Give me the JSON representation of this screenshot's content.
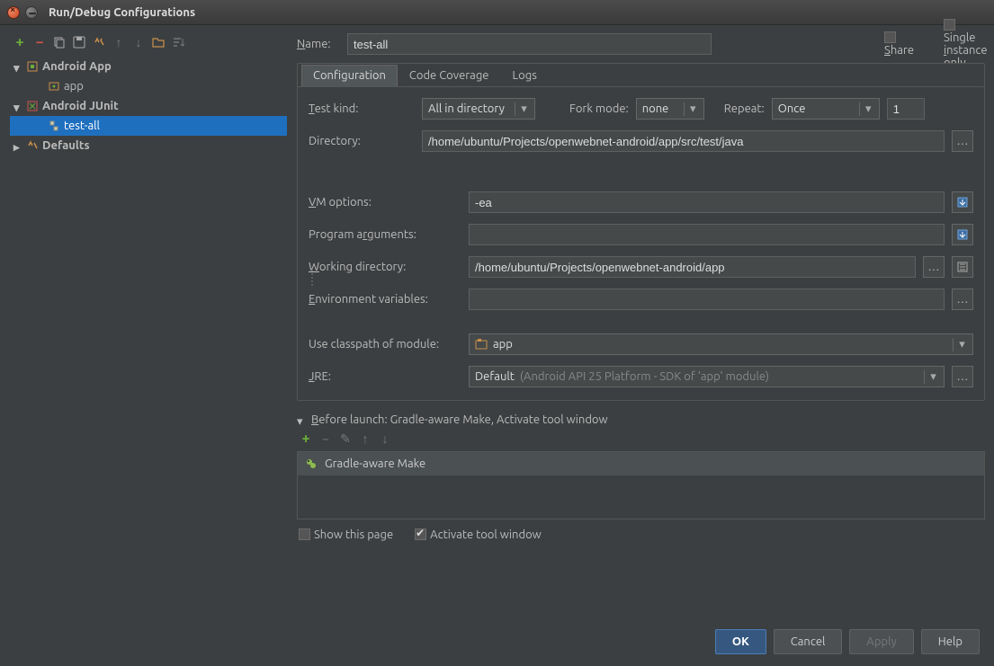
{
  "window": {
    "title": "Run/Debug Configurations"
  },
  "toolbar": {
    "addTip": "Add",
    "removeTip": "Remove",
    "copyTip": "Copy",
    "saveTip": "Save",
    "settingsTip": "Edit defaults",
    "upTip": "Move up",
    "downTip": "Move down",
    "folderTip": "Folder",
    "sortTip": "Sort"
  },
  "tree": {
    "androidApp": "Android App",
    "appItem": "app",
    "androidJUnit": "Android JUnit",
    "testAll": "test-all",
    "defaults": "Defaults"
  },
  "header": {
    "nameLabel": "Name:",
    "nameValue": "test-all",
    "shareLabel": "Share",
    "singleLabel": "Single instance only"
  },
  "tabs": {
    "config": "Configuration",
    "coverage": "Code Coverage",
    "logs": "Logs"
  },
  "config": {
    "testKindLabel": "Test kind:",
    "testKindValue": "All in directory",
    "forkLabel": "Fork mode:",
    "forkValue": "none",
    "repeatLabel": "Repeat:",
    "repeatValue": "Once",
    "repeatCount": "1",
    "directoryLabel": "Directory:",
    "directoryValue": "/home/ubuntu/Projects/openwebnet-android/app/src/test/java",
    "vmLabel": "VM options:",
    "vmValue": "-ea",
    "argsLabel": "Program arguments:",
    "argsValue": "",
    "workdirLabel": "Working directory:",
    "workdirValue": "/home/ubuntu/Projects/openwebnet-android/app",
    "envLabel": "Environment variables:",
    "envValue": "",
    "classpathLabel": "Use classpath of module:",
    "classpathValue": "app",
    "jreLabel": "JRE:",
    "jreValue": "Default",
    "jreHint": "(Android API 25 Platform - SDK of 'app' module)"
  },
  "beforeLaunch": {
    "header": "Before launch: Gradle-aware Make, Activate tool window",
    "item": "Gradle-aware Make",
    "showPage": "Show this page",
    "activateWindow": "Activate tool window"
  },
  "footer": {
    "ok": "OK",
    "cancel": "Cancel",
    "apply": "Apply",
    "help": "Help"
  }
}
